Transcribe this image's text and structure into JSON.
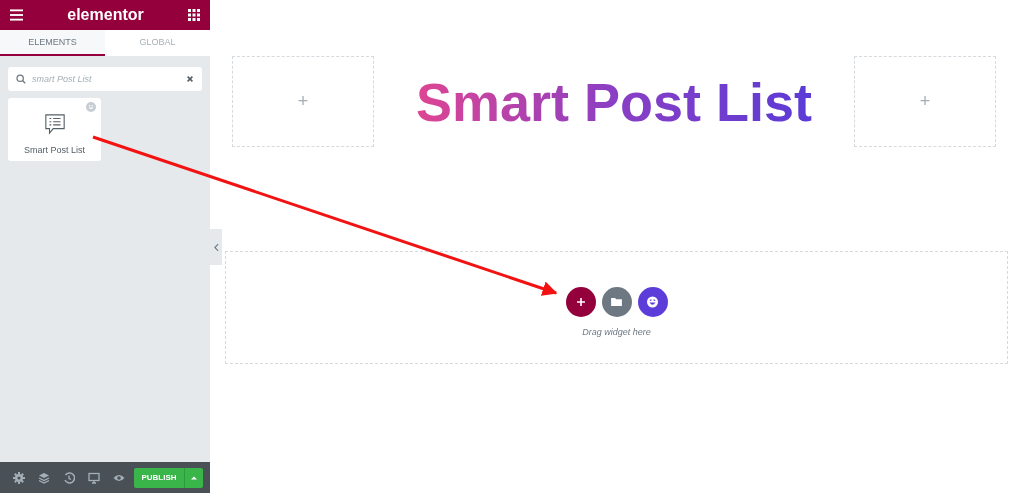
{
  "sidebar": {
    "logo": "elementor",
    "tabs": [
      {
        "label": "ELEMENTS",
        "selected": true
      },
      {
        "label": "GLOBAL",
        "selected": false
      }
    ],
    "search": {
      "value": "smart Post List"
    },
    "widgets": [
      {
        "label": "Smart Post List"
      }
    ],
    "footer": {
      "publish": "PUBLISH"
    }
  },
  "canvas": {
    "columns": [
      {
        "kind": "empty",
        "text": "+"
      },
      {
        "kind": "heading",
        "text": "Smart Post List"
      },
      {
        "kind": "empty",
        "text": "+"
      }
    ],
    "drop_zone": {
      "hint": "Drag widget here"
    }
  }
}
